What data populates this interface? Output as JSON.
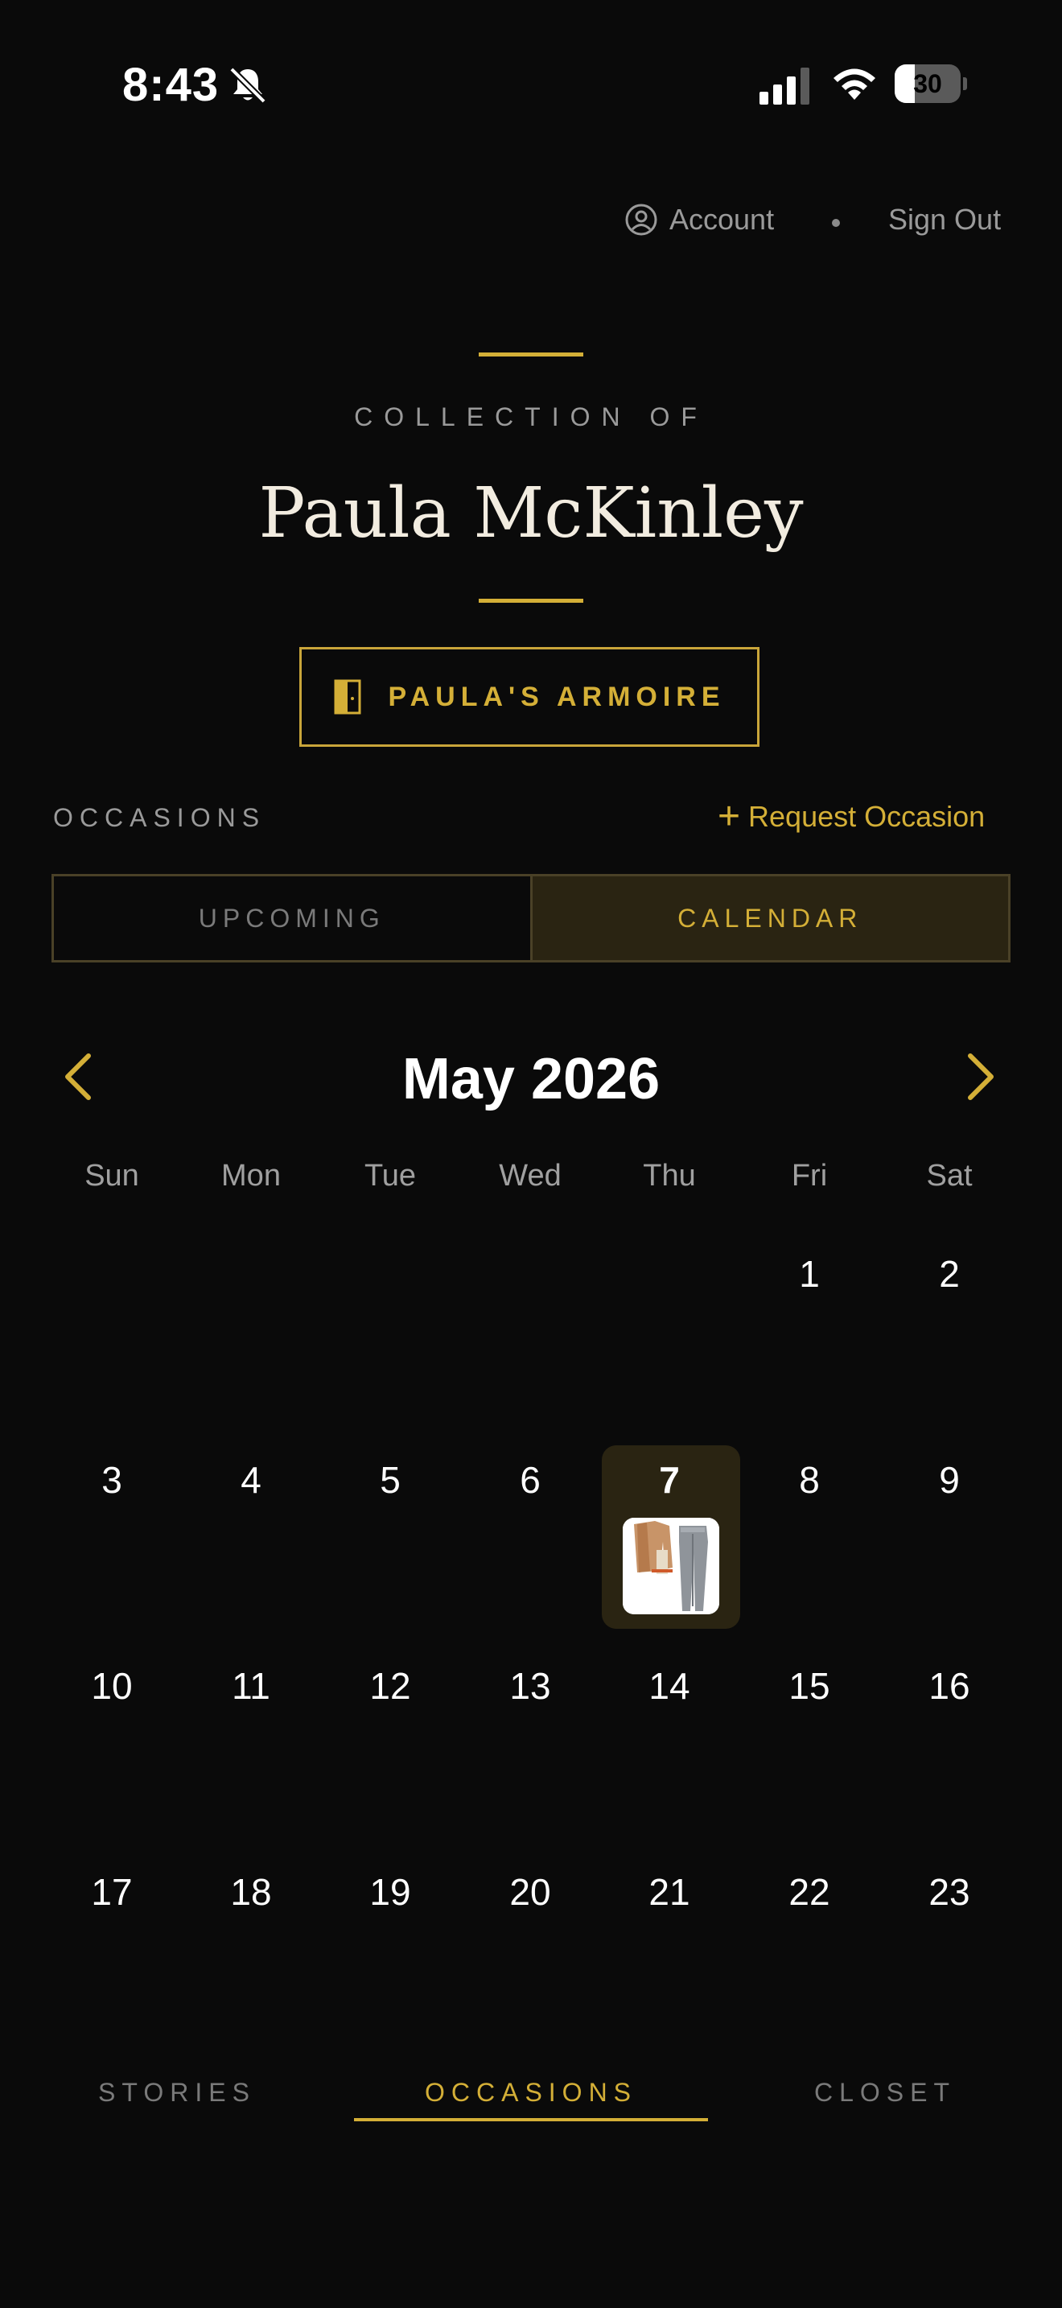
{
  "status_bar": {
    "time": "8:43",
    "battery": "30",
    "battery_level": 0.3
  },
  "header": {
    "account_label": "Account",
    "sign_out_label": "Sign Out"
  },
  "profile": {
    "eyebrow": "COLLECTION OF",
    "name": "Paula McKinley",
    "armoire_button": "PAULA'S ARMOIRE"
  },
  "occasions": {
    "section_label": "OCCASIONS",
    "request_label": "Request Occasion",
    "tabs": [
      {
        "label": "UPCOMING",
        "active": false
      },
      {
        "label": "CALENDAR",
        "active": true
      }
    ]
  },
  "calendar": {
    "month_title": "May 2026",
    "weekdays": [
      "Sun",
      "Mon",
      "Tue",
      "Wed",
      "Thu",
      "Fri",
      "Sat"
    ],
    "weeks": [
      [
        "",
        "",
        "",
        "",
        "",
        "1",
        "2"
      ],
      [
        "3",
        "4",
        "5",
        "6",
        "7",
        "8",
        "9"
      ],
      [
        "10",
        "11",
        "12",
        "13",
        "14",
        "15",
        "16"
      ],
      [
        "17",
        "18",
        "19",
        "20",
        "21",
        "22",
        "23"
      ]
    ],
    "highlighted_day": "7",
    "accent_color": "#d4af37"
  },
  "bottom_nav": {
    "items": [
      {
        "label": "STORIES",
        "active": false
      },
      {
        "label": "OCCASIONS",
        "active": true
      },
      {
        "label": "CLOSET",
        "active": false
      }
    ]
  }
}
